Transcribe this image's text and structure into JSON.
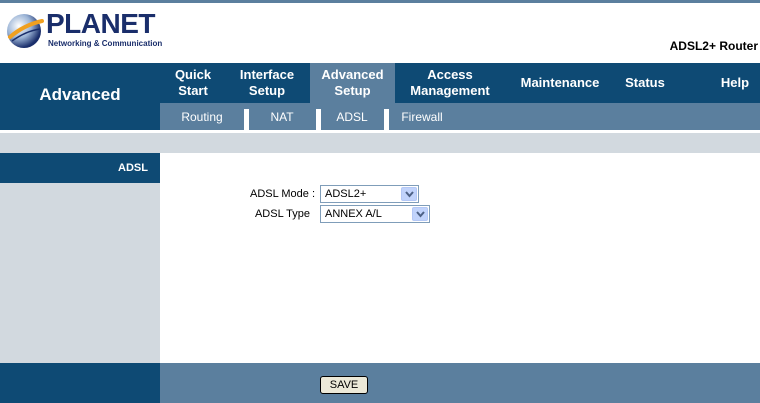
{
  "header": {
    "brand": "PLANET",
    "tagline": "Networking & Communication",
    "product": "ADSL2+ Router"
  },
  "nav": {
    "section_title": "Advanced",
    "menu": [
      {
        "line1": "Quick",
        "line2": "Start"
      },
      {
        "line1": "Interface",
        "line2": "Setup"
      },
      {
        "line1": "Advanced",
        "line2": "Setup",
        "active": true
      },
      {
        "line1": "Access",
        "line2": "Management"
      },
      {
        "line1": "Maintenance",
        "line2": ""
      },
      {
        "line1": "Status",
        "line2": ""
      },
      {
        "line1": "Help",
        "line2": ""
      }
    ],
    "submenu": [
      "Routing",
      "NAT",
      "ADSL",
      "Firewall"
    ]
  },
  "sidebar": {
    "heading": "ADSL"
  },
  "form": {
    "mode_label": "ADSL Mode :",
    "mode_value": "ADSL2+",
    "type_label": "ADSL Type",
    "type_value": "ANNEX A/L"
  },
  "footer": {
    "save_label": "SAVE"
  },
  "colors": {
    "navy": "#0e4a74",
    "steel": "#5b7f9e",
    "light_gray": "#d2d9df"
  }
}
